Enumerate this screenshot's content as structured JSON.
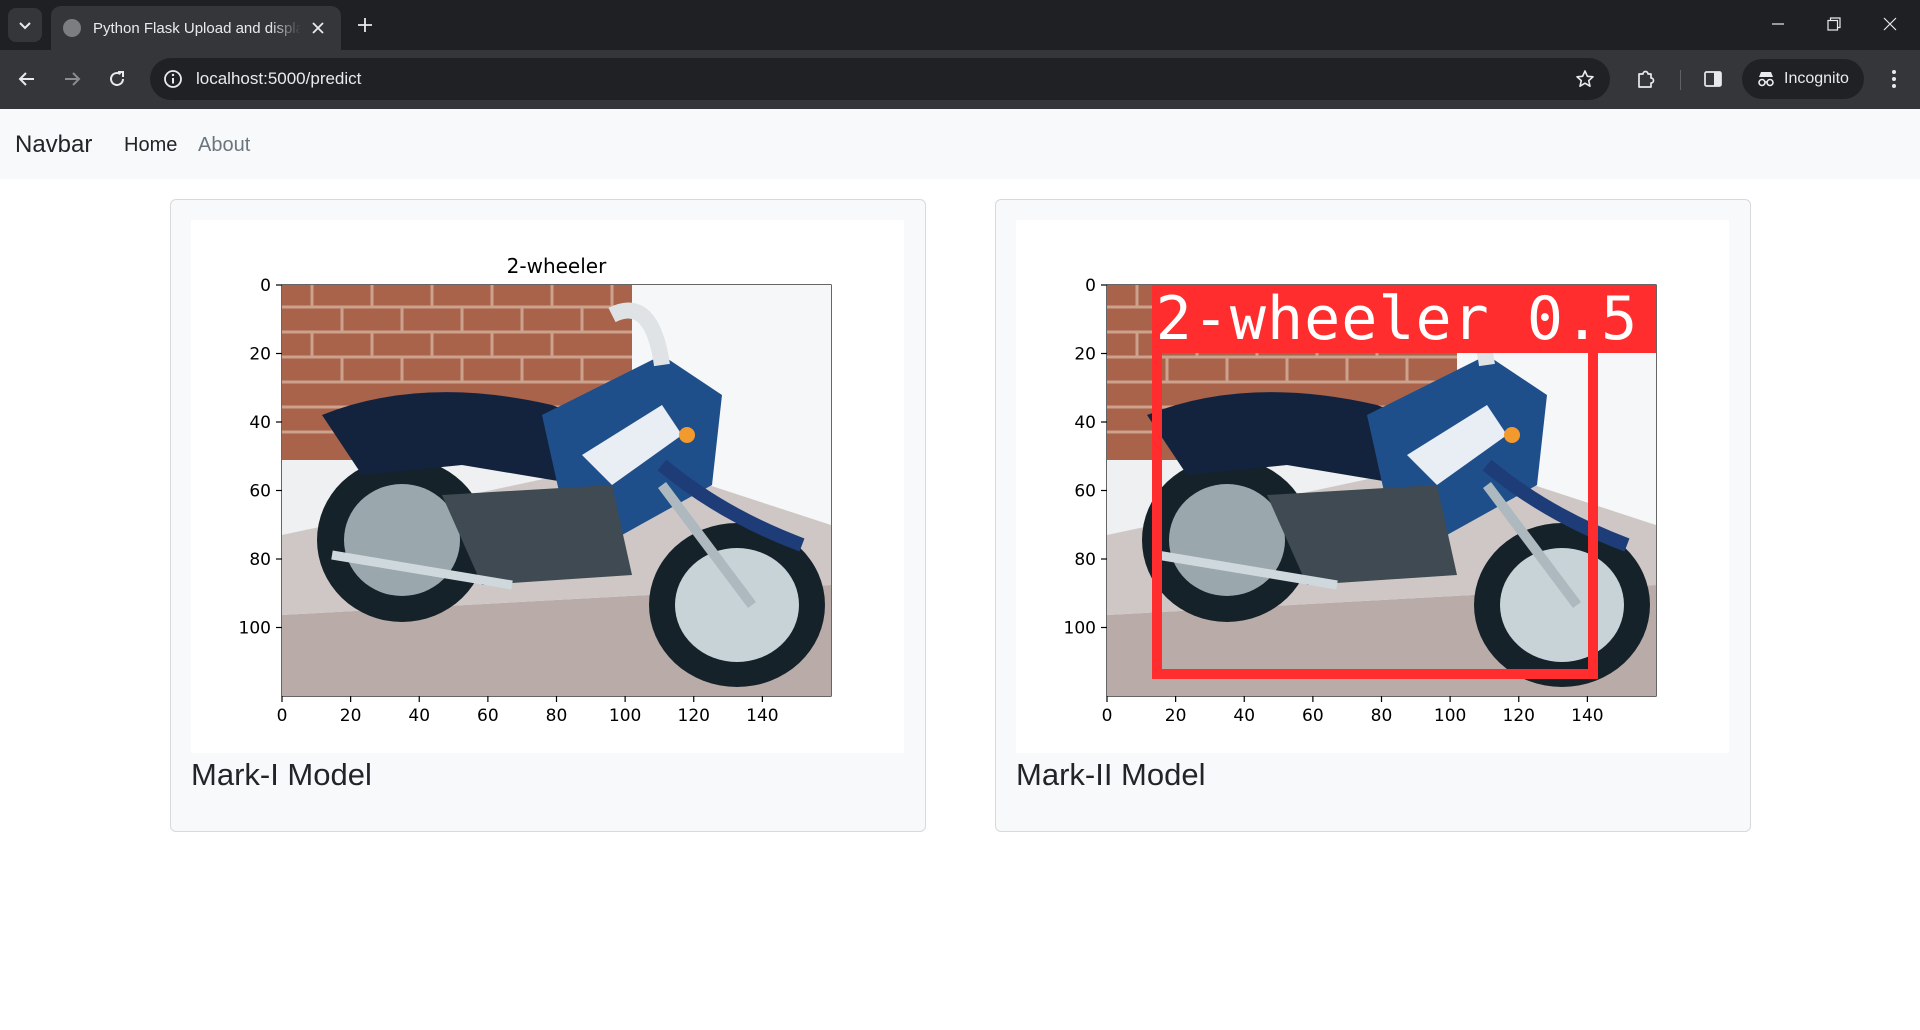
{
  "browser": {
    "tab_title": "Python Flask Upload and display image",
    "url": "localhost:5000/predict",
    "incognito_label": "Incognito"
  },
  "navbar": {
    "brand": "Navbar",
    "links": [
      {
        "label": "Home",
        "active": true
      },
      {
        "label": "About",
        "active": false
      }
    ]
  },
  "cards": [
    {
      "caption": "Mark-I Model",
      "plot": {
        "title": "2-wheeler",
        "x_ticks": [
          "0",
          "20",
          "40",
          "60",
          "80",
          "100",
          "120",
          "140"
        ],
        "y_ticks": [
          "0",
          "20",
          "40",
          "60",
          "80",
          "100"
        ],
        "image_width": 160,
        "image_height": 120
      }
    },
    {
      "caption": "Mark-II Model",
      "plot": {
        "title": "",
        "x_ticks": [
          "0",
          "20",
          "40",
          "60",
          "80",
          "100",
          "120",
          "140"
        ],
        "y_ticks": [
          "0",
          "20",
          "40",
          "60",
          "80",
          "100"
        ],
        "image_width": 160,
        "image_height": 120,
        "detection": {
          "label": "2-wheeler 0.5",
          "color": "#ff2d2d",
          "x_min": 13,
          "x_max": 143,
          "y_min": 0,
          "y_max": 115
        }
      }
    }
  ],
  "colors": {
    "navbar_bg": "#f8f9fa",
    "card_bg": "#f8f9fa",
    "chrome_bg": "#35363a",
    "detection_box": "#ff2d2d"
  }
}
